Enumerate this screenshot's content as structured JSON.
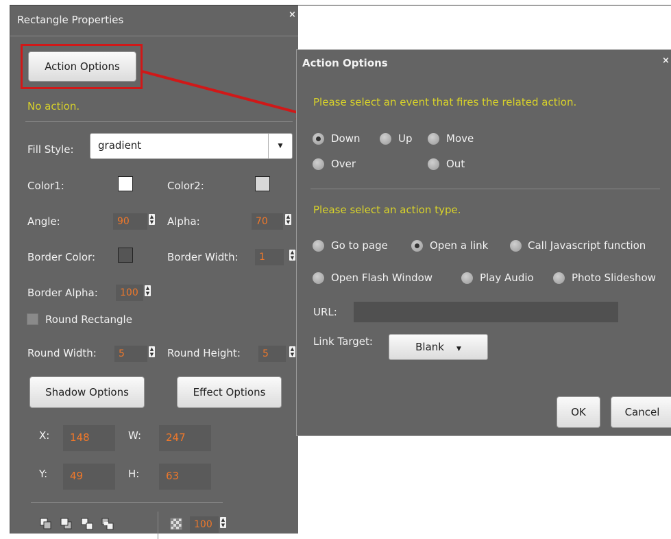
{
  "rect_panel": {
    "title": "Rectangle Properties",
    "close_glyph": "×",
    "action_options_button": "Action Options",
    "status_text": "No action.",
    "fill_style": {
      "label": "Fill Style:",
      "value": "gradient"
    },
    "color1": {
      "label": "Color1:",
      "color": "#ffffff"
    },
    "color2": {
      "label": "Color2:",
      "color": "#d8d8d8"
    },
    "angle": {
      "label": "Angle:",
      "value": "90"
    },
    "alpha": {
      "label": "Alpha:",
      "value": "70"
    },
    "border_color": {
      "label": "Border Color:",
      "color": "#555555"
    },
    "border_width": {
      "label": "Border Width:",
      "value": "1"
    },
    "border_alpha": {
      "label": "Border Alpha:",
      "value": "100"
    },
    "round_rectangle": {
      "label": "Round Rectangle",
      "checked": false
    },
    "round_width": {
      "label": "Round Width:",
      "value": "5"
    },
    "round_height": {
      "label": "Round Height:",
      "value": "5"
    },
    "shadow_options_button": "Shadow Options",
    "effect_options_button": "Effect Options",
    "coords": {
      "x_label": "X:",
      "x": "148",
      "w_label": "W:",
      "w": "247",
      "y_label": "Y:",
      "y": "49",
      "h_label": "H:",
      "h": "63"
    },
    "toolbar": {
      "icons": [
        "bring-to-front-icon",
        "send-to-back-icon",
        "bring-forward-icon",
        "send-backward-icon",
        "transparency-icon"
      ],
      "opacity_value": "100"
    }
  },
  "action_dialog": {
    "title": "Action Options",
    "close_glyph": "×",
    "event_prompt": "Please select an event that fires the related action.",
    "events": [
      {
        "label": "Down",
        "selected": true
      },
      {
        "label": "Up",
        "selected": false
      },
      {
        "label": "Move",
        "selected": false
      },
      {
        "label": "Over",
        "selected": false
      },
      {
        "label": "Out",
        "selected": false
      }
    ],
    "action_prompt": "Please select an action type.",
    "actions": [
      {
        "label": "Go to page",
        "selected": false
      },
      {
        "label": "Open a link",
        "selected": true
      },
      {
        "label": "Call Javascript function",
        "selected": false
      },
      {
        "label": "Open Flash Window",
        "selected": false
      },
      {
        "label": "Play Audio",
        "selected": false
      },
      {
        "label": "Photo Slideshow",
        "selected": false
      }
    ],
    "url_label": "URL:",
    "url_value": "",
    "link_target_label": "Link Target:",
    "link_target_value": "Blank",
    "ok_button": "OK",
    "cancel_button": "Cancel"
  },
  "colors": {
    "panel_bg": "#646464",
    "accent_yellow": "#d8d22a",
    "value_orange": "#f0782a",
    "highlight_red": "#d01818"
  }
}
